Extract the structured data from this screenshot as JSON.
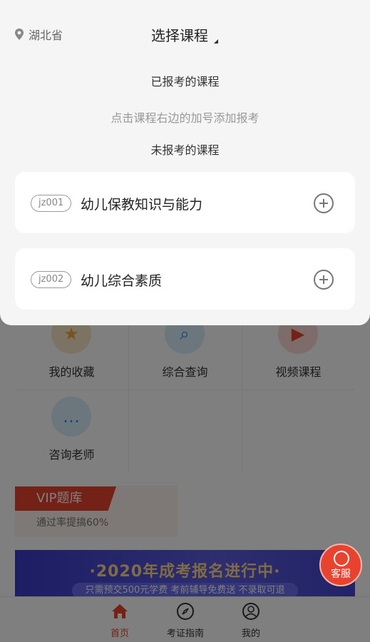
{
  "header": {
    "location": "湖北省",
    "title": "选择课程"
  },
  "sections": {
    "enrolled_label": "已报考的课程",
    "hint": "点击课程右边的加号添加报考",
    "not_enrolled_label": "未报考的课程"
  },
  "courses": [
    {
      "code": "jz001",
      "name": "幼儿保教知识与能力"
    },
    {
      "code": "jz002",
      "name": "幼儿综合素质"
    }
  ],
  "background": {
    "grid": [
      "我的收藏",
      "综合查询",
      "视频课程",
      "咨询老师"
    ],
    "vip": {
      "tag": "VIP题库",
      "subtitle": "通过率提搞60%"
    },
    "banner": {
      "title": "·2020年成考报名进行中·",
      "subtitle": "只需预交500元学费 考前辅导免费送 不录取可退"
    },
    "service_label": "客服"
  },
  "tabbar": [
    {
      "label": "首页",
      "active": true
    },
    {
      "label": "考证指南",
      "active": false
    },
    {
      "label": "我的",
      "active": false
    }
  ],
  "colors": {
    "accent": "#e8432e",
    "overlay": "rgba(0,0,0,0.5)"
  }
}
